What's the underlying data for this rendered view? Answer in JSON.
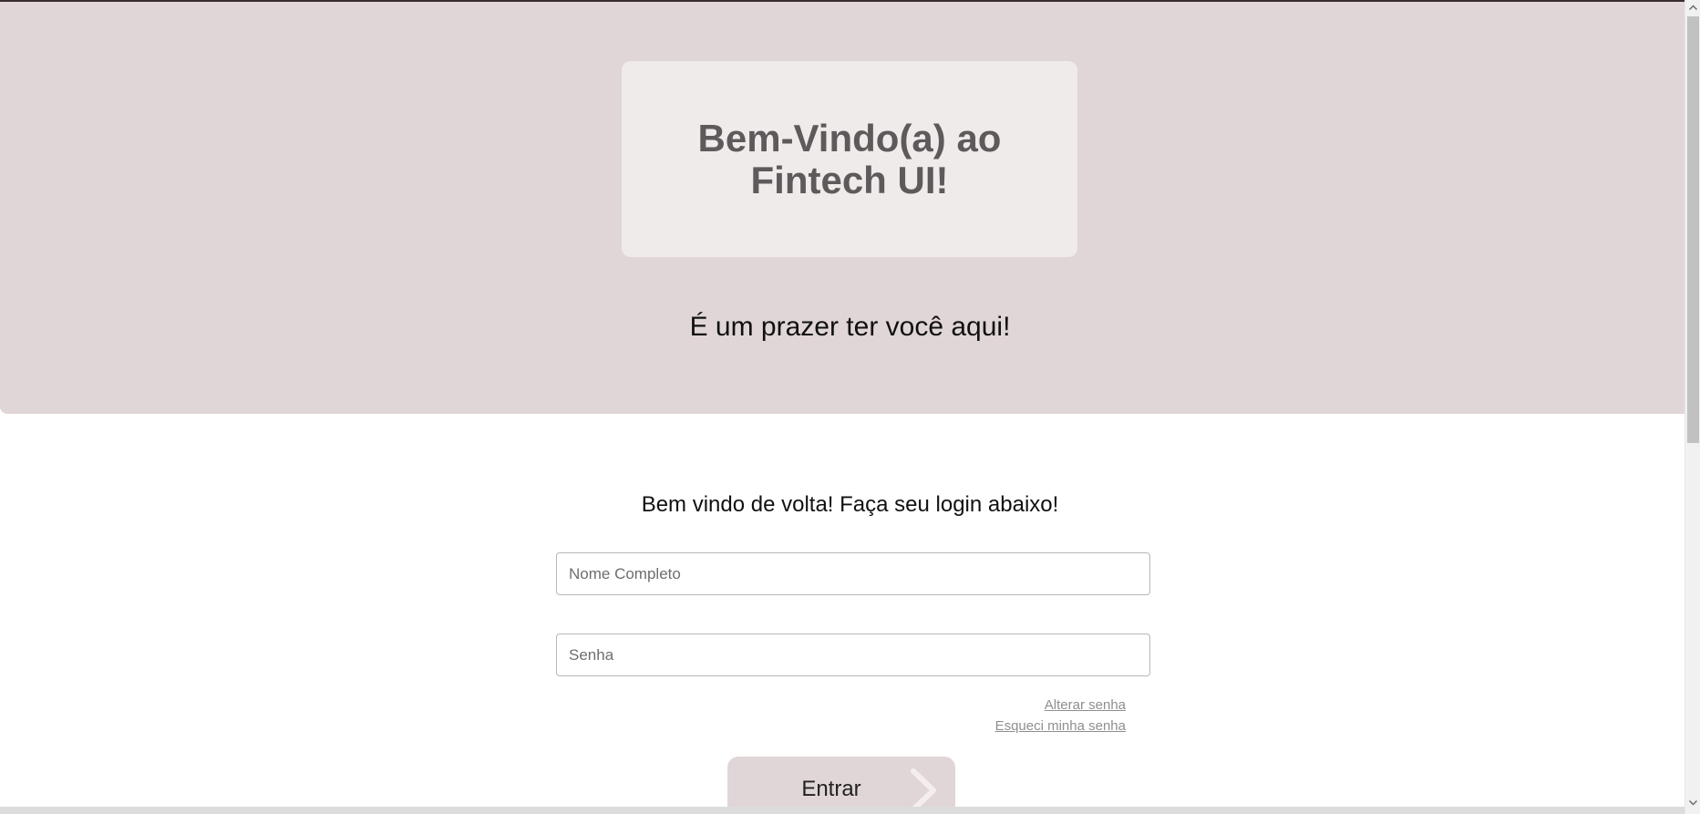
{
  "hero": {
    "title": "Bem-Vindo(a) ao Fintech UI!",
    "subtitle": "É um prazer ter você aqui!"
  },
  "login": {
    "heading": "Bem vindo de volta! Faça seu login abaixo!",
    "name_placeholder": "Nome Completo",
    "password_placeholder": "Senha",
    "change_password_label": "Alterar senha",
    "forgot_password_label": "Esqueci minha senha",
    "submit_label": "Entrar",
    "submit_icon": "chevron-right-icon"
  },
  "colors": {
    "hero_background": "#e1d6d7",
    "card_background": "#f0ebeb",
    "title_text": "#5e5a5b",
    "link_text": "#8f8f8f"
  }
}
